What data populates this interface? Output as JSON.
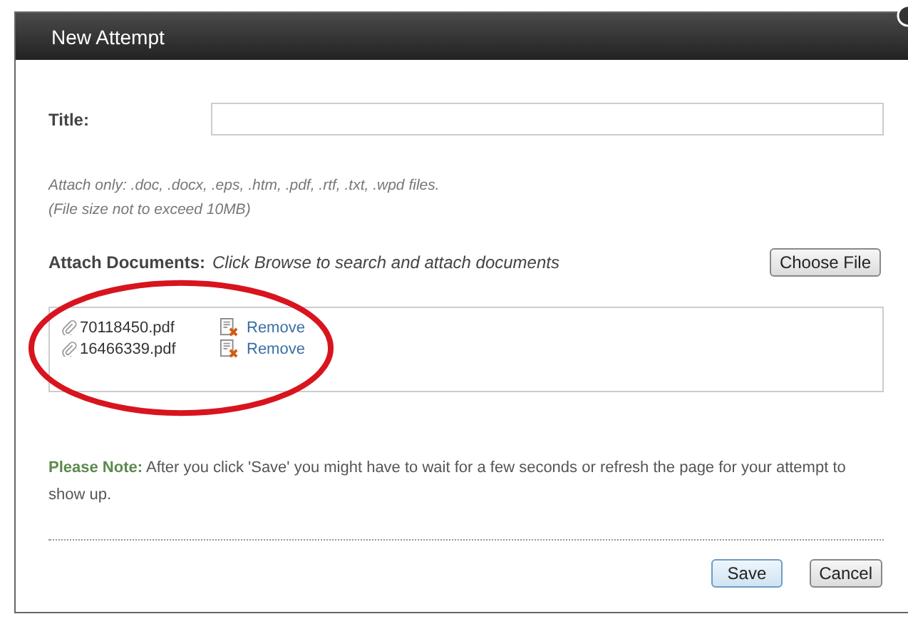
{
  "dialog": {
    "title": "New Attempt"
  },
  "title_field": {
    "label": "Title:"
  },
  "hints": [
    "Attach only: .doc, .docx, .eps, .htm, .pdf, .rtf, .txt, .wpd files.",
    "(File size not to exceed 10MB)"
  ],
  "attach": {
    "label": "Attach Documents:",
    "instruction": "Click Browse to search and attach documents",
    "button": "Choose File"
  },
  "files": [
    {
      "name": "70118450.pdf",
      "action": "Remove"
    },
    {
      "name": "16466339.pdf",
      "action": "Remove"
    }
  ],
  "note": "**Please Note:** After you click 'Save' you might have to wait for a few seconds or refresh the page for your attempt to show up.",
  "buttons": [
    "Save",
    "Cancel"
  ]
}
